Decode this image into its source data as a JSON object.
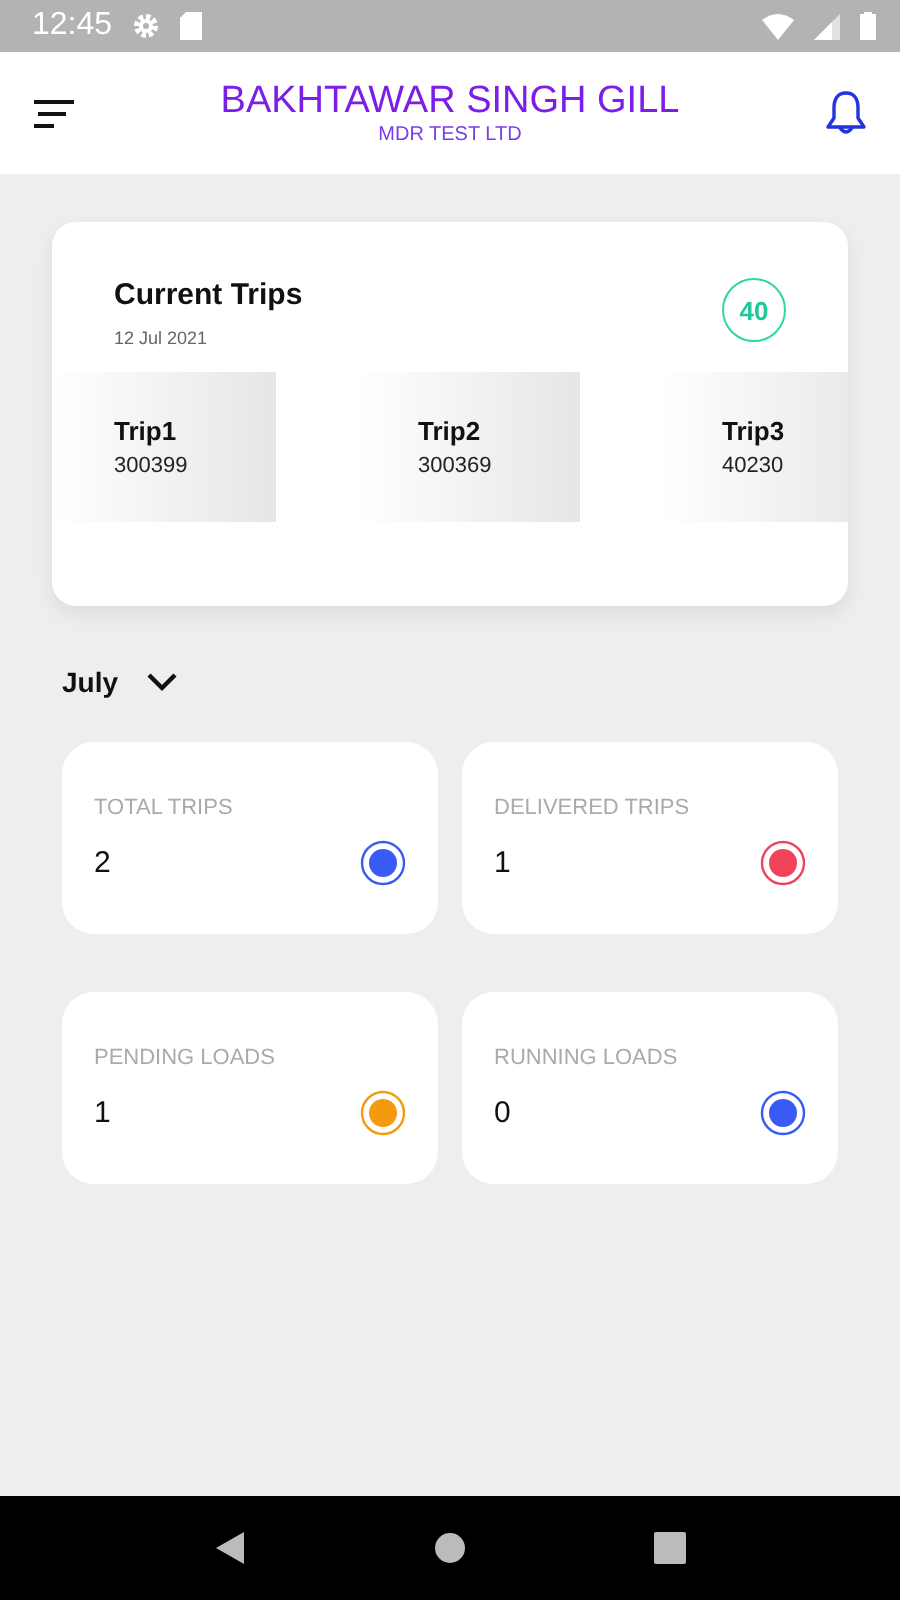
{
  "status_bar": {
    "time": "12:45"
  },
  "header": {
    "title": "BAKHTAWAR SINGH GILL",
    "subtitle": "MDR TEST LTD"
  },
  "current_trips": {
    "title": "Current Trips",
    "date": "12 Jul 2021",
    "count": "40",
    "trips": [
      {
        "name": "Trip1",
        "number": "300399"
      },
      {
        "name": "Trip2",
        "number": "300369"
      },
      {
        "name": "Trip3",
        "number": "40230"
      }
    ]
  },
  "month_picker": {
    "value": "July"
  },
  "stats": [
    {
      "label": "TOTAL TRIPS",
      "value": "2",
      "color": "#3a5af5"
    },
    {
      "label": "DELIVERED TRIPS",
      "value": "1",
      "color": "#f0425a"
    },
    {
      "label": "PENDING LOADS",
      "value": "1",
      "color": "#f59a0c"
    },
    {
      "label": "RUNNING LOADS",
      "value": "0",
      "color": "#3a5af5"
    }
  ]
}
